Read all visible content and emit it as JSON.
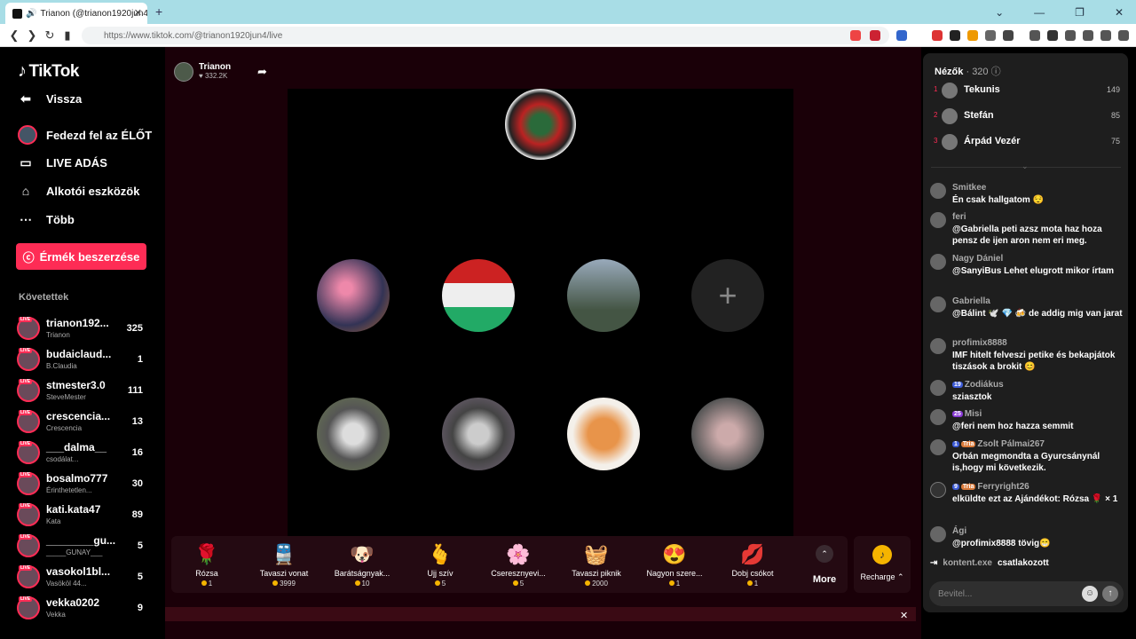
{
  "browser": {
    "tab_title": "Trianon (@trianon1920jun4)",
    "url": "https://www.tiktok.com/@trianon1920jun4/live"
  },
  "sidebar": {
    "logo": "TikTok",
    "nav": [
      {
        "label": "Vissza",
        "icon": "back-arrow-icon"
      },
      {
        "label": "Fedezd fel az ÉLŐT",
        "icon": "live-explore-icon"
      },
      {
        "label": "LIVE ADÁS",
        "icon": "camera-icon"
      },
      {
        "label": "Alkotói eszközök",
        "icon": "creator-tools-icon"
      },
      {
        "label": "Több",
        "icon": "more-dots-icon"
      }
    ],
    "coin_button": "Érmék beszerzése",
    "following_title": "Követettek",
    "following": [
      {
        "name": "trianon192...",
        "sub": "Trianon",
        "count": "325"
      },
      {
        "name": "budaiclaud...",
        "sub": "B.Claudia",
        "count": "1"
      },
      {
        "name": "stmester3.0",
        "sub": "SteveMester",
        "count": "111"
      },
      {
        "name": "crescencia...",
        "sub": "Crescencia",
        "count": "13"
      },
      {
        "name": "___dalma__",
        "sub": "csodálat...",
        "count": "16"
      },
      {
        "name": "bosalmo777",
        "sub": "Érinthetetlen...",
        "count": "30"
      },
      {
        "name": "kati.kata47",
        "sub": "Kata",
        "count": "89"
      },
      {
        "name": "________gu...",
        "sub": "_____GUNAY___",
        "count": "5"
      },
      {
        "name": "vasokol1bl...",
        "sub": "Vasököl 44...",
        "count": "5"
      },
      {
        "name": "vekka0202",
        "sub": "Vekka",
        "count": "9"
      }
    ],
    "live_badge": "LIVE"
  },
  "stream": {
    "host_name": "Trianon",
    "likes": "332.2K",
    "add_seat": "+"
  },
  "gifts": [
    {
      "emoji": "🌹",
      "name": "Rózsa",
      "price": "1"
    },
    {
      "emoji": "🚆",
      "name": "Tavaszi vonat",
      "price": "3999"
    },
    {
      "emoji": "🐶",
      "name": "Barátságnyak...",
      "price": "10"
    },
    {
      "emoji": "🫰",
      "name": "Ujj szív",
      "price": "5"
    },
    {
      "emoji": "🌸",
      "name": "Cseresznyevi...",
      "price": "5"
    },
    {
      "emoji": "🧺",
      "name": "Tavaszi piknik",
      "price": "2000"
    },
    {
      "emoji": "😍",
      "name": "Nagyon szere...",
      "price": "1"
    },
    {
      "emoji": "💋",
      "name": "Dobj csókot",
      "price": "1"
    }
  ],
  "more_label": "More",
  "recharge_label": "Recharge",
  "viewers": {
    "title": "Nézők",
    "count": "· 320",
    "top": [
      {
        "rank": "1",
        "name": "Tekunis",
        "score": "149"
      },
      {
        "rank": "2",
        "name": "Stefán",
        "score": "85"
      },
      {
        "rank": "3",
        "name": "Árpád Vezér",
        "score": "75"
      }
    ]
  },
  "chat": [
    {
      "user": "Smitkee",
      "badges": [],
      "text": "Én csak hallgatom 😌"
    },
    {
      "user": "feri",
      "badges": [],
      "text": "@Gabriella peti azsz mota haz hoza pensz de ijen aron nem eri meg."
    },
    {
      "user": "Nagy Dániel",
      "badges": [],
      "text": "@SanyiBus Lehet elugrott mikor írtam"
    },
    {
      "user": "Gabriella",
      "badges": [],
      "text": "@Bálint 🕊️ 💎 🍻 de addig mig van jarat"
    },
    {
      "user": "profimix8888",
      "badges": [],
      "text": "IMF hitelt felveszi petike és bekapjátok tiszások a brokit 😊"
    },
    {
      "user": "Zodiákus",
      "badges": [
        "19"
      ],
      "text": "sziasztok"
    },
    {
      "user": "Misi",
      "badges": [
        "25"
      ],
      "text": "@feri nem hoz hazza semmit"
    },
    {
      "user": "Zsolt Pálmai267",
      "badges": [
        "1",
        "Tria"
      ],
      "text": "Orbán megmondta a Gyurcsánynál is,hogy mi következik."
    },
    {
      "user": "Ferryright26",
      "badges": [
        "9",
        "Tria"
      ],
      "text": "elküldte ezt az Ajándékot: Rózsa 🌹 × 1"
    },
    {
      "user": "Ági",
      "badges": [],
      "text": "@profimix8888 tövig😁"
    }
  ],
  "join": {
    "user": "kontent.exe",
    "text": "csatlakozott"
  },
  "input_placeholder": "Bevitel..."
}
